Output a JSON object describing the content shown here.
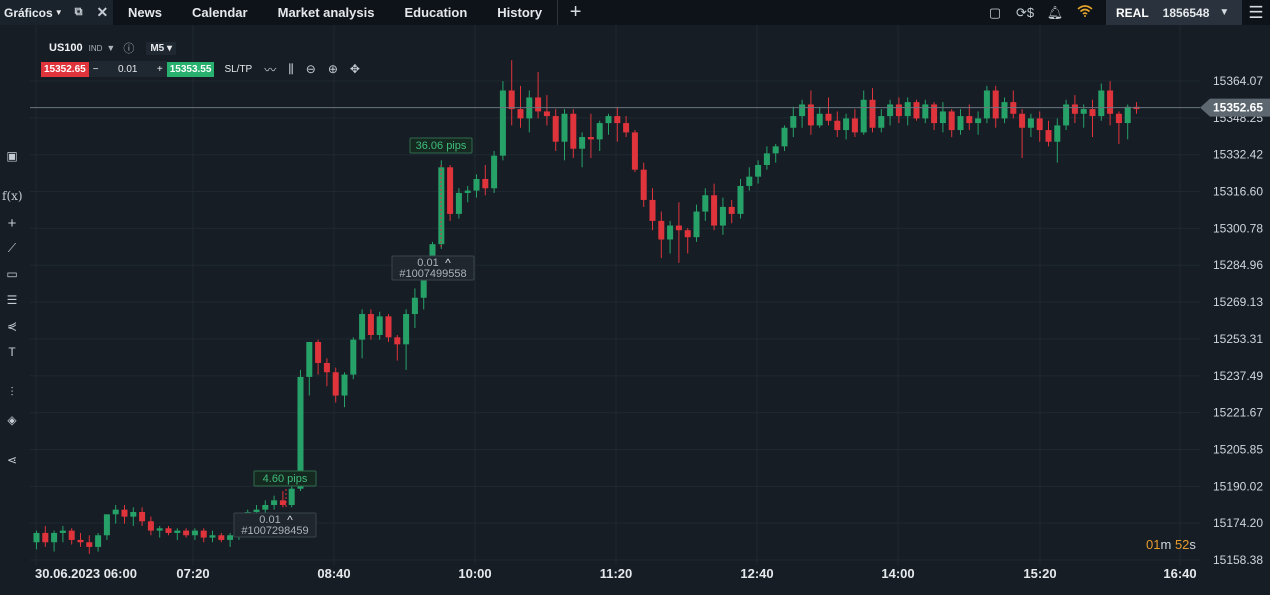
{
  "topbar": {
    "active_tab": "Gráficos",
    "nav": [
      "News",
      "Calendar",
      "Market analysis",
      "Education",
      "History"
    ],
    "account_mode": "REAL",
    "account_number": "1856548"
  },
  "instrument": {
    "symbol": "US100",
    "type": "IND",
    "timeframe": "M5",
    "sell_price": "15352.65",
    "lot": "0.01",
    "buy_price": "15353.55",
    "sltp_label": "SL/TP"
  },
  "price_axis": [
    "15364.07",
    "15348.25",
    "15332.42",
    "15316.60",
    "15300.78",
    "15284.96",
    "15269.13",
    "15253.31",
    "15237.49",
    "15221.67",
    "15205.85",
    "15190.02",
    "15174.20",
    "15158.38"
  ],
  "current_price": "15352.65",
  "time_axis": [
    "30.06.2023 06:00",
    "07:20",
    "08:40",
    "10:00",
    "11:20",
    "12:40",
    "14:00",
    "15:20",
    "16:40"
  ],
  "orders": [
    {
      "pips": "4.60 pips",
      "lot": "0.01",
      "id": "#1007298459"
    },
    {
      "pips": "36.06 pips",
      "lot": "0.01",
      "id": "#1007499558"
    }
  ],
  "timer": {
    "minutes": "01",
    "m": "m",
    "seconds": "52",
    "s": "s"
  },
  "chart_data": {
    "type": "candlestick",
    "title": "US100",
    "timeframe": "M5",
    "xlabel": "",
    "ylabel": "",
    "ylim": [
      15158.38,
      15370
    ],
    "colors": {
      "up": "#26a269",
      "down": "#e0343c"
    },
    "candles": [
      [
        15166,
        15171,
        15163,
        15170
      ],
      [
        15170,
        15173,
        15164,
        15166
      ],
      [
        15166,
        15171,
        15162,
        15170
      ],
      [
        15170,
        15173,
        15166,
        15171
      ],
      [
        15171,
        15172,
        15165,
        15167
      ],
      [
        15167,
        15170,
        15164,
        15166
      ],
      [
        15166,
        15169,
        15161,
        15164
      ],
      [
        15164,
        15170,
        15162,
        15169
      ],
      [
        15169,
        15175,
        15167,
        15178
      ],
      [
        15178,
        15182,
        15174,
        15180
      ],
      [
        15180,
        15182,
        15174,
        15177
      ],
      [
        15177,
        15181,
        15173,
        15179
      ],
      [
        15179,
        15181,
        15173,
        15175
      ],
      [
        15175,
        15177,
        15169,
        15171
      ],
      [
        15171,
        15173,
        15168,
        15172
      ],
      [
        15172,
        15173,
        15169,
        15170
      ],
      [
        15170,
        15172,
        15167,
        15171
      ],
      [
        15171,
        15172,
        15168,
        15169
      ],
      [
        15169,
        15172,
        15167,
        15171
      ],
      [
        15171,
        15172,
        15166,
        15168
      ],
      [
        15168,
        15171,
        15166,
        15169
      ],
      [
        15169,
        15170,
        15166,
        15167
      ],
      [
        15167,
        15170,
        15164,
        15169
      ],
      [
        15169,
        15175,
        15167,
        15173
      ],
      [
        15173,
        15180,
        15172,
        15179
      ],
      [
        15179,
        15182,
        15177,
        15180
      ],
      [
        15180,
        15184,
        15178,
        15182
      ],
      [
        15182,
        15186,
        15180,
        15184
      ],
      [
        15184,
        15188,
        15181,
        15182
      ],
      [
        15182,
        15190,
        15181,
        15189
      ],
      [
        15189,
        15240,
        15188,
        15237
      ],
      [
        15237,
        15252,
        15229,
        15252
      ],
      [
        15252,
        15253,
        15238,
        15243
      ],
      [
        15243,
        15245,
        15233,
        15239
      ],
      [
        15239,
        15241,
        15226,
        15229
      ],
      [
        15229,
        15239,
        15224,
        15238
      ],
      [
        15238,
        15254,
        15236,
        15253
      ],
      [
        15253,
        15266,
        15245,
        15264
      ],
      [
        15264,
        15266,
        15253,
        15255
      ],
      [
        15255,
        15265,
        15253,
        15263
      ],
      [
        15263,
        15264,
        15252,
        15254
      ],
      [
        15254,
        15255,
        15244,
        15251
      ],
      [
        15251,
        15266,
        15240,
        15264
      ],
      [
        15264,
        15275,
        15258,
        15271
      ],
      [
        15271,
        15288,
        15266,
        15285
      ],
      [
        15285,
        15295,
        15283,
        15294
      ],
      [
        15294,
        15330,
        15292,
        15327
      ],
      [
        15327,
        15328,
        15304,
        15307
      ],
      [
        15307,
        15318,
        15305,
        15316
      ],
      [
        15316,
        15319,
        15312,
        15317
      ],
      [
        15317,
        15324,
        15314,
        15322
      ],
      [
        15322,
        15328,
        15315,
        15318
      ],
      [
        15318,
        15334,
        15316,
        15332
      ],
      [
        15332,
        15364,
        15330,
        15360
      ],
      [
        15360,
        15373,
        15345,
        15352
      ],
      [
        15352,
        15362,
        15344,
        15348
      ],
      [
        15348,
        15360,
        15342,
        15357
      ],
      [
        15357,
        15368,
        15348,
        15351
      ],
      [
        15351,
        15358,
        15345,
        15349
      ],
      [
        15349,
        15352,
        15334,
        15338
      ],
      [
        15338,
        15352,
        15330,
        15350
      ],
      [
        15350,
        15352,
        15331,
        15335
      ],
      [
        15335,
        15342,
        15327,
        15340
      ],
      [
        15340,
        15350,
        15331,
        15339
      ],
      [
        15339,
        15347,
        15334,
        15346
      ],
      [
        15346,
        15350,
        15341,
        15349
      ],
      [
        15349,
        15353,
        15338,
        15346
      ],
      [
        15346,
        15349,
        15340,
        15342
      ],
      [
        15342,
        15343,
        15325,
        15326
      ],
      [
        15326,
        15329,
        15310,
        15313
      ],
      [
        15313,
        15318,
        15300,
        15304
      ],
      [
        15304,
        15308,
        15288,
        15296
      ],
      [
        15296,
        15304,
        15290,
        15302
      ],
      [
        15302,
        15312,
        15286,
        15300
      ],
      [
        15300,
        15301,
        15290,
        15297
      ],
      [
        15297,
        15311,
        15295,
        15308
      ],
      [
        15308,
        15318,
        15304,
        15315
      ],
      [
        15315,
        15320,
        15300,
        15302
      ],
      [
        15302,
        15314,
        15298,
        15310
      ],
      [
        15310,
        15313,
        15303,
        15307
      ],
      [
        15307,
        15322,
        15305,
        15319
      ],
      [
        15319,
        15327,
        15317,
        15323
      ],
      [
        15323,
        15330,
        15320,
        15328
      ],
      [
        15328,
        15336,
        15326,
        15333
      ],
      [
        15333,
        15337,
        15329,
        15336
      ],
      [
        15336,
        15345,
        15334,
        15344
      ],
      [
        15344,
        15353,
        15340,
        15349
      ],
      [
        15349,
        15356,
        15344,
        15354
      ],
      [
        15354,
        15360,
        15341,
        15345
      ],
      [
        15345,
        15353,
        15344,
        15350
      ],
      [
        15350,
        15357,
        15345,
        15347
      ],
      [
        15347,
        15351,
        15340,
        15343
      ],
      [
        15343,
        15350,
        15339,
        15348
      ],
      [
        15348,
        15352,
        15340,
        15342
      ],
      [
        15342,
        15360,
        15341,
        15356
      ],
      [
        15356,
        15361,
        15342,
        15344
      ],
      [
        15344,
        15352,
        15342,
        15349
      ],
      [
        15349,
        15356,
        15345,
        15354
      ],
      [
        15354,
        15357,
        15346,
        15349
      ],
      [
        15349,
        15357,
        15345,
        15355
      ],
      [
        15355,
        15356,
        15347,
        15348
      ],
      [
        15348,
        15356,
        15346,
        15354
      ],
      [
        15354,
        15355,
        15343,
        15346
      ],
      [
        15346,
        15355,
        15342,
        15351
      ],
      [
        15351,
        15352,
        15340,
        15343
      ],
      [
        15343,
        15352,
        15341,
        15349
      ],
      [
        15349,
        15354,
        15343,
        15346
      ],
      [
        15346,
        15351,
        15341,
        15348
      ],
      [
        15348,
        15362,
        15346,
        15360
      ],
      [
        15360,
        15362,
        15344,
        15348
      ],
      [
        15348,
        15357,
        15346,
        15355
      ],
      [
        15355,
        15360,
        15348,
        15350
      ],
      [
        15350,
        15352,
        15331,
        15344
      ],
      [
        15344,
        15350,
        15340,
        15348
      ],
      [
        15348,
        15351,
        15338,
        15343
      ],
      [
        15343,
        15347,
        15336,
        15338
      ],
      [
        15338,
        15348,
        15329,
        15345
      ],
      [
        15345,
        15356,
        15343,
        15354
      ],
      [
        15354,
        15358,
        15346,
        15350
      ],
      [
        15350,
        15354,
        15344,
        15352
      ],
      [
        15352,
        15356,
        15340,
        15349
      ],
      [
        15349,
        15363,
        15347,
        15360
      ],
      [
        15360,
        15364,
        15345,
        15350
      ],
      [
        15350,
        15351,
        15337,
        15346
      ],
      [
        15346,
        15354,
        15339,
        15353
      ],
      [
        15353,
        15355,
        15350,
        15352
      ]
    ]
  }
}
